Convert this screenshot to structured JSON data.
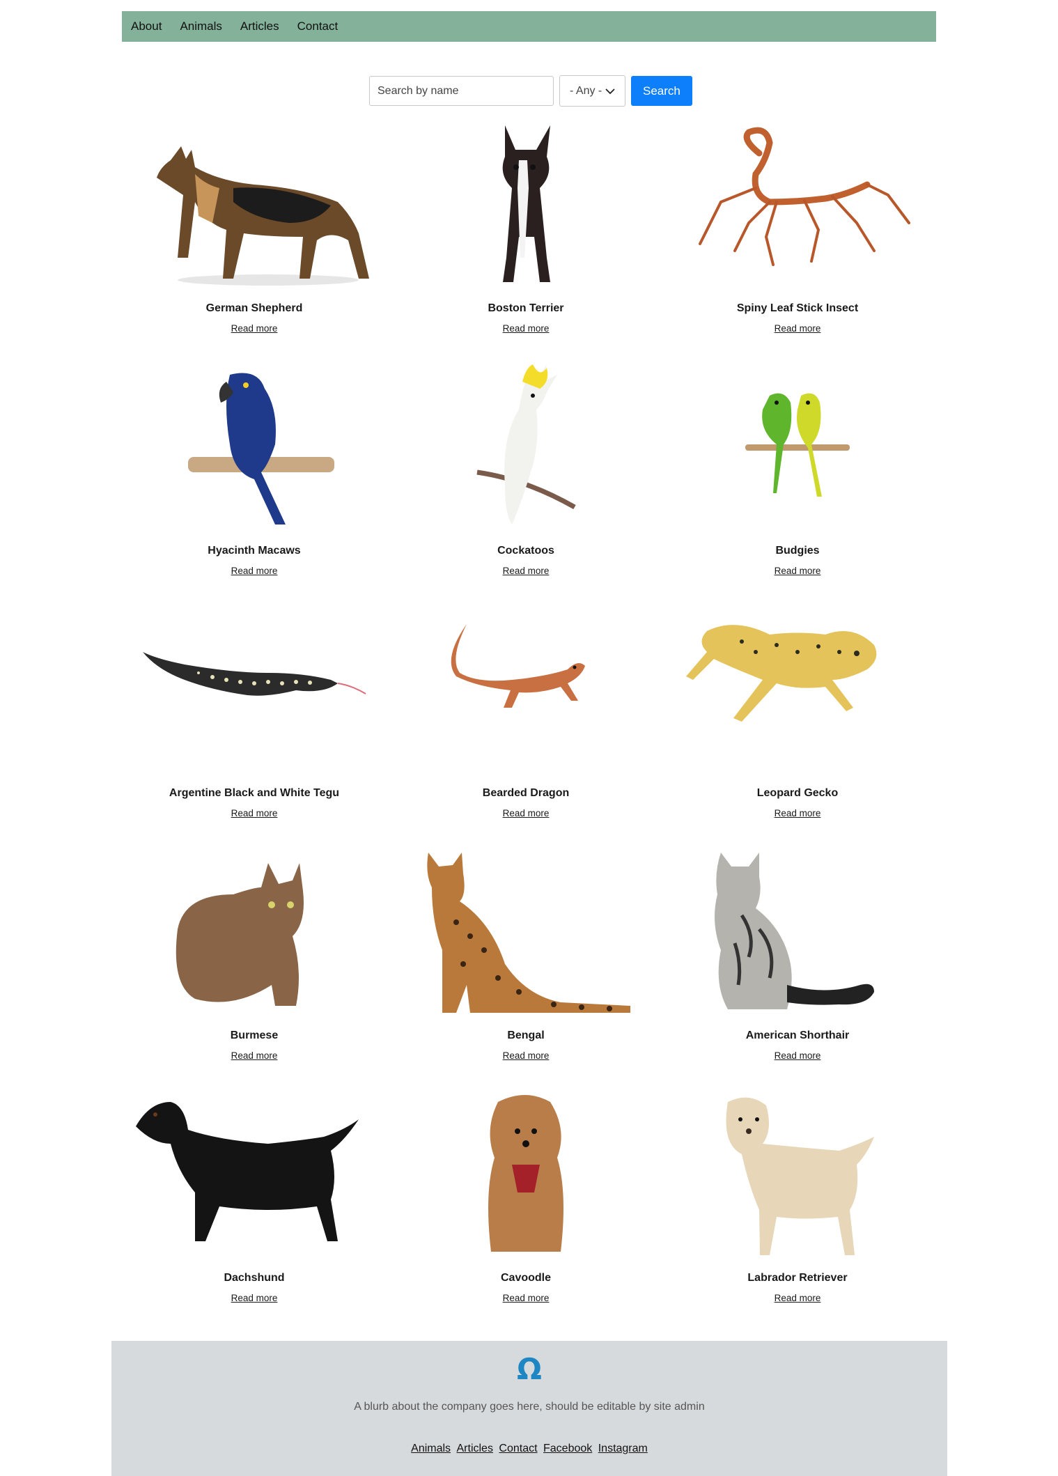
{
  "nav": {
    "items": [
      "About",
      "Animals",
      "Articles",
      "Contact"
    ]
  },
  "search": {
    "placeholder": "Search by name",
    "select_value": "- Any -",
    "button_label": "Search"
  },
  "animals": [
    {
      "name": "German Shepherd",
      "link": "Read more",
      "icon": "german-shepherd-image"
    },
    {
      "name": "Boston Terrier",
      "link": "Read more",
      "icon": "boston-terrier-image"
    },
    {
      "name": "Spiny Leaf Stick Insect",
      "link": "Read more",
      "icon": "stick-insect-image"
    },
    {
      "name": "Hyacinth Macaws",
      "link": "Read more",
      "icon": "macaw-image"
    },
    {
      "name": "Cockatoos",
      "link": "Read more",
      "icon": "cockatoo-image"
    },
    {
      "name": "Budgies",
      "link": "Read more",
      "icon": "budgies-image"
    },
    {
      "name": "Argentine Black and White Tegu",
      "link": "Read more",
      "icon": "tegu-image"
    },
    {
      "name": "Bearded Dragon",
      "link": "Read more",
      "icon": "bearded-dragon-image"
    },
    {
      "name": "Leopard Gecko",
      "link": "Read more",
      "icon": "leopard-gecko-image"
    },
    {
      "name": "Burmese",
      "link": "Read more",
      "icon": "burmese-cat-image"
    },
    {
      "name": "Bengal",
      "link": "Read more",
      "icon": "bengal-cat-image"
    },
    {
      "name": "American Shorthair",
      "link": "Read more",
      "icon": "american-shorthair-image"
    },
    {
      "name": "Dachshund",
      "link": "Read more",
      "icon": "dachshund-image"
    },
    {
      "name": "Cavoodle",
      "link": "Read more",
      "icon": "cavoodle-image"
    },
    {
      "name": "Labrador Retriever",
      "link": "Read more",
      "icon": "labrador-image"
    }
  ],
  "footer": {
    "logo": "Ω",
    "blurb": "A blurb about the company goes here, should be editable by site admin",
    "links": [
      "Animals",
      "Articles",
      "Contact",
      "Facebook",
      "Instagram"
    ]
  },
  "colors": {
    "nav_bg": "#84b19a",
    "search_button": "#0d7ffb",
    "footer_bg": "#d7dadd",
    "logo": "#1e86c2"
  }
}
